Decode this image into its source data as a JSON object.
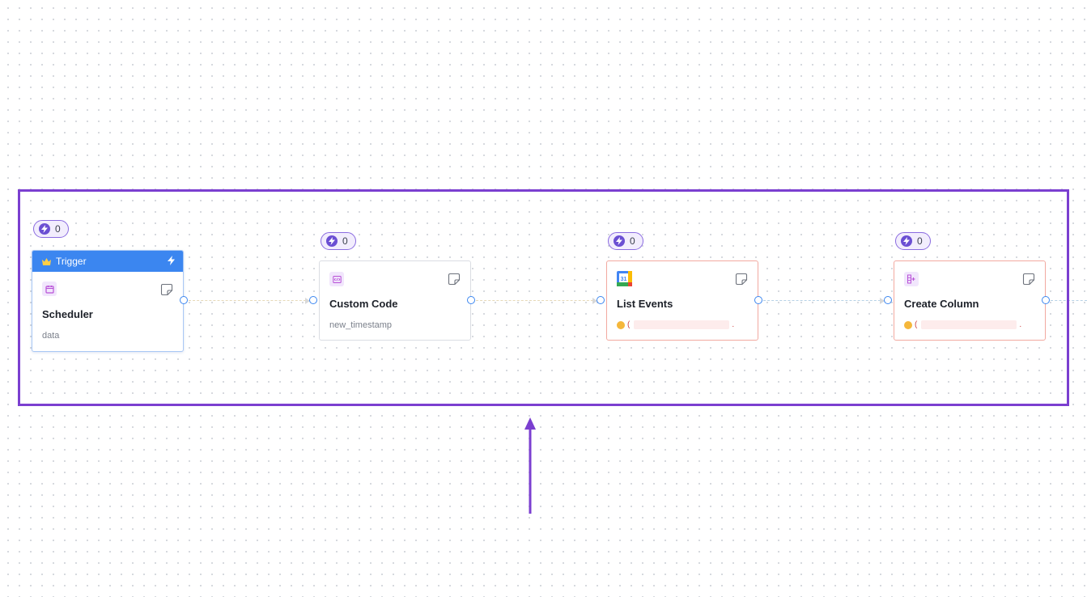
{
  "highlight_color": "#7b3fd0",
  "nodes": {
    "trigger": {
      "badge_count": "0",
      "header_label": "Trigger",
      "header_icon": "crown-icon",
      "header_color": "#3b86f0",
      "icon": "calendar-icon",
      "title": "Scheduler",
      "subtitle": "data"
    },
    "custom_code": {
      "badge_count": "0",
      "icon": "code-icon",
      "title": "Custom Code",
      "subtitle": "new_timestamp"
    },
    "list_events": {
      "badge_count": "0",
      "icon": "google-calendar-icon",
      "title": "List Events",
      "error_prefix": "(",
      "error_suffix": "."
    },
    "create_column": {
      "badge_count": "0",
      "icon": "table-add-column-icon",
      "title": "Create Column",
      "error_prefix": "(",
      "error_suffix": "."
    }
  }
}
